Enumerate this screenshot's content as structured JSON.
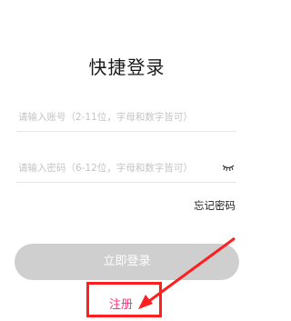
{
  "title": "快捷登录",
  "account_field": {
    "placeholder": "请输入账号（2-11位，字母和数字皆可）",
    "value": ""
  },
  "password_field": {
    "placeholder": "请输入密码（6-12位，字母和数字皆可）",
    "value": "",
    "toggle_icon": "eye-closed-icon"
  },
  "forgot_password": "忘记密码",
  "login_button": "立即登录",
  "register_link": "注册",
  "colors": {
    "register": "#ff2e7a",
    "annotation": "#ff1f1f",
    "button_disabled": "#cfcfcf"
  }
}
